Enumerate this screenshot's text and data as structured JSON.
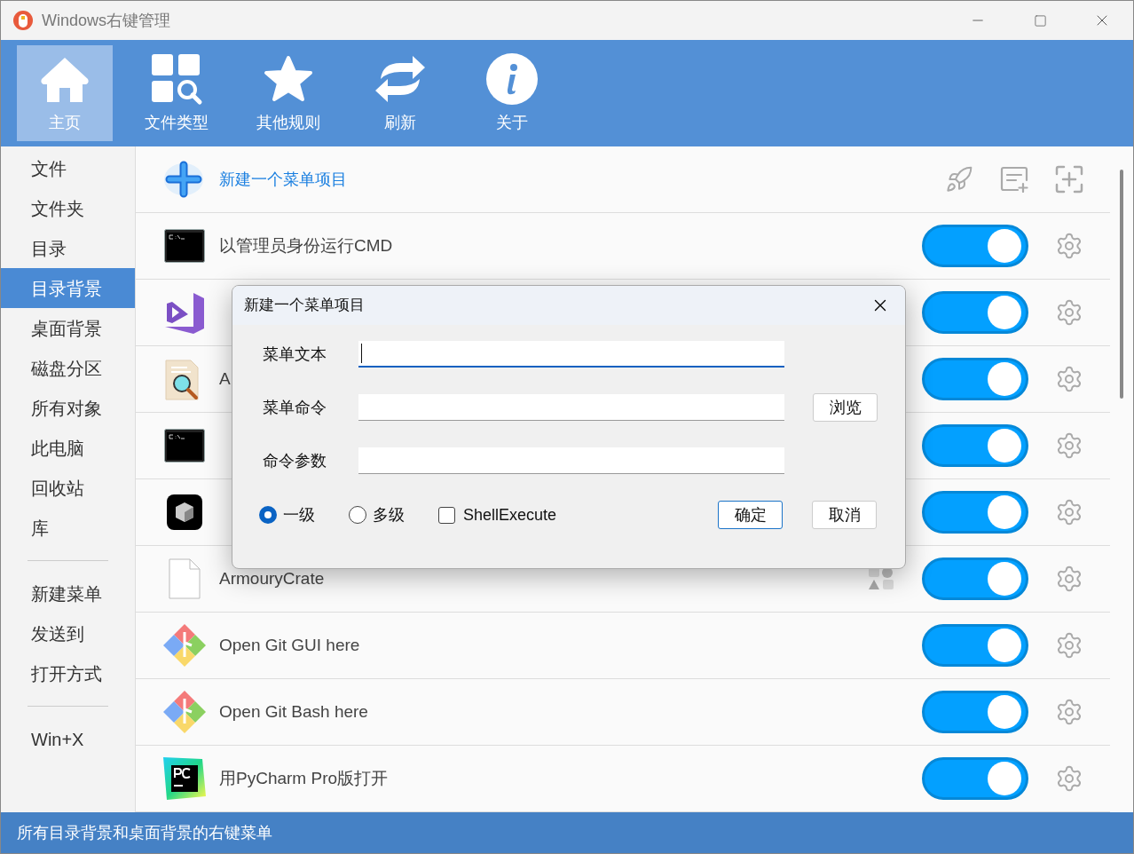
{
  "window": {
    "title": "Windows右键管理"
  },
  "toolbar": [
    {
      "kind": "home",
      "label": "主页",
      "selected": true
    },
    {
      "kind": "filetypes",
      "label": "文件类型",
      "selected": false
    },
    {
      "kind": "star",
      "label": "其他规则",
      "selected": false
    },
    {
      "kind": "refresh",
      "label": "刷新",
      "selected": false
    },
    {
      "kind": "info",
      "label": "关于",
      "selected": false
    }
  ],
  "sidebar": {
    "groups": [
      {
        "items": [
          {
            "label": "文件",
            "selected": false
          },
          {
            "label": "文件夹",
            "selected": false
          },
          {
            "label": "目录",
            "selected": false
          },
          {
            "label": "目录背景",
            "selected": true
          },
          {
            "label": "桌面背景",
            "selected": false
          },
          {
            "label": "磁盘分区",
            "selected": false
          },
          {
            "label": "所有对象",
            "selected": false
          },
          {
            "label": "此电脑",
            "selected": false
          },
          {
            "label": "回收站",
            "selected": false
          },
          {
            "label": "库",
            "selected": false
          }
        ]
      },
      {
        "items": [
          {
            "label": "新建菜单",
            "selected": false
          },
          {
            "label": "发送到",
            "selected": false
          },
          {
            "label": "打开方式",
            "selected": false
          }
        ]
      },
      {
        "items": [
          {
            "label": "Win+X",
            "selected": false
          }
        ]
      }
    ]
  },
  "new_item": {
    "label": "新建一个菜单项目"
  },
  "rows": [
    {
      "kind": "cmd",
      "label": "以管理员身份运行CMD",
      "on": true,
      "shapes_icon": false
    },
    {
      "kind": "vs",
      "on": true,
      "shapes_icon": false
    },
    {
      "kind": "search-doc",
      "label": "A",
      "on": true,
      "shapes_icon": false
    },
    {
      "kind": "cmd",
      "on": true,
      "shapes_icon": false
    },
    {
      "kind": "cube",
      "on": true,
      "shapes_icon": false
    },
    {
      "kind": "file",
      "label": "ArmouryCrate",
      "on": true,
      "shapes_icon": true
    },
    {
      "kind": "git",
      "label": "Open Git GUI here",
      "on": true,
      "shapes_icon": false
    },
    {
      "kind": "git",
      "label": "Open Git Bash here",
      "on": true,
      "shapes_icon": false
    },
    {
      "kind": "pycharm",
      "label": "用PyCharm Pro版打开",
      "on": true,
      "shapes_icon": false
    }
  ],
  "dialog": {
    "title": "新建一个菜单项目",
    "fields": [
      {
        "label": "菜单文本",
        "focused": true
      },
      {
        "label": "菜单命令",
        "focused": false,
        "button": "浏览"
      },
      {
        "label": "命令参数",
        "focused": false
      }
    ],
    "radios": [
      {
        "label": "一级",
        "selected": true
      },
      {
        "label": "多级",
        "selected": false
      }
    ],
    "checkbox": {
      "label": "ShellExecute",
      "checked": false
    },
    "buttons": [
      {
        "label": "确定",
        "default": true
      },
      {
        "label": "取消",
        "default": false
      }
    ]
  },
  "status_bar": {
    "text": "所有目录背景和桌面背景的右键菜单"
  }
}
